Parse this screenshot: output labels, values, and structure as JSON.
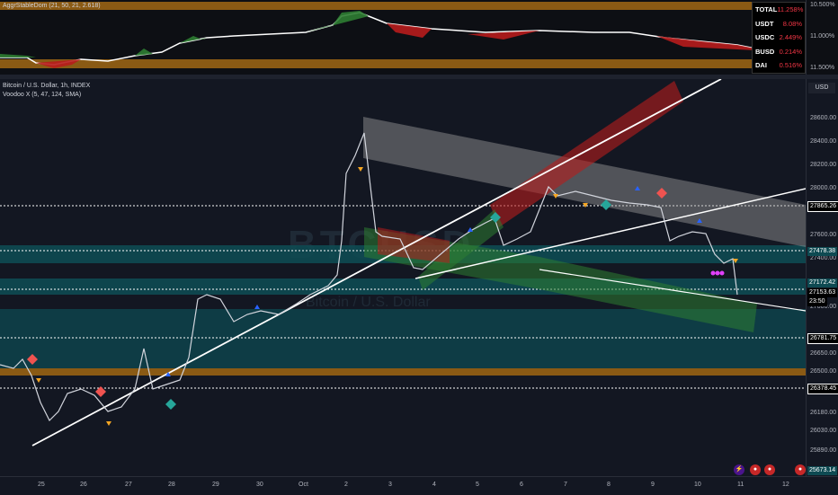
{
  "top_indicator": {
    "legend": "AggrStableDom (21, 50, 21, 2.618)",
    "axis_ticks": [
      "10.500%",
      "11.000%",
      "11.500%"
    ],
    "dominance_table": [
      {
        "name": "TOTAL",
        "value": "11.258%"
      },
      {
        "name": "USDT",
        "value": "8.08%"
      },
      {
        "name": "USDC",
        "value": "2.449%"
      },
      {
        "name": "BUSD",
        "value": "0.214%"
      },
      {
        "name": "DAI",
        "value": "0.516%"
      }
    ]
  },
  "main_chart": {
    "symbol_legend": "Bitcoin / U.S. Dollar, 1h, INDEX",
    "indicator_legend": "Voodoo X (5, 47, 124, SMA)",
    "currency_button": "USD",
    "watermark": "BTCUSD",
    "watermark_sub": "Bitcoin / U.S. Dollar",
    "price_ticks": [
      "28600.00",
      "28400.00",
      "28200.00",
      "28000.00",
      "27600.00",
      "27400.00",
      "27000.00",
      "26650.00",
      "26500.00",
      "26180.00",
      "26030.00",
      "25890.00"
    ],
    "price_tags": [
      {
        "label": "27865.26",
        "kind": "level"
      },
      {
        "label": "27478.38",
        "kind": "zone"
      },
      {
        "label": "27172.42",
        "kind": "zone"
      },
      {
        "label": "27153.63",
        "kind": "current"
      },
      {
        "label": "23:50",
        "kind": "current"
      },
      {
        "label": "26781.75",
        "kind": "level"
      },
      {
        "label": "26378.45",
        "kind": "level"
      },
      {
        "label": "25673.14",
        "kind": "zone"
      }
    ],
    "time_labels": [
      "25",
      "26",
      "27",
      "28",
      "29",
      "30",
      "Oct",
      "2",
      "3",
      "4",
      "5",
      "6",
      "7",
      "8",
      "9",
      "10",
      "11",
      "12"
    ],
    "colors": {
      "bull": "#26a69a",
      "bear": "#ef5350",
      "zone": "#0e4a52",
      "orange_band": "#8a5a14"
    }
  }
}
